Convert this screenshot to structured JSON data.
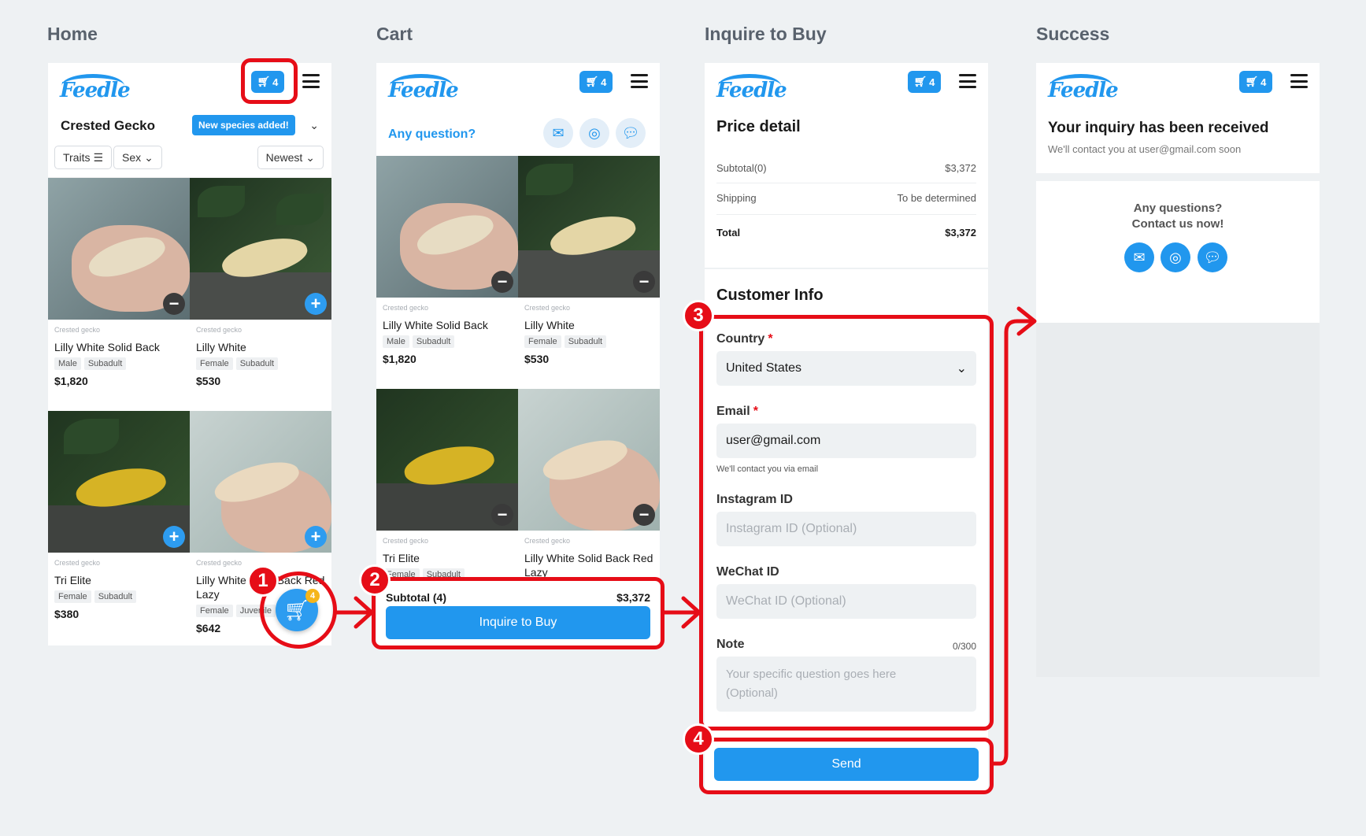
{
  "columns": {
    "home": "Home",
    "cart": "Cart",
    "inquire": "Inquire to Buy",
    "success": "Success"
  },
  "brand": {
    "logo": "Feedle",
    "cart_count": "4",
    "accent": "#2197ee",
    "annotation_color": "#e60d17"
  },
  "home": {
    "species": "Crested Gecko",
    "tooltip": "New species added!",
    "filters": {
      "traits": "Traits",
      "sex": "Sex",
      "sort": "Newest"
    },
    "products": [
      {
        "kind": "Crested gecko",
        "name": "Lilly White Solid Back",
        "tags": [
          "Male",
          "Subadult"
        ],
        "price": "$1,820",
        "action": "minus"
      },
      {
        "kind": "Crested gecko",
        "name": "Lilly White",
        "tags": [
          "Female",
          "Subadult"
        ],
        "price": "$530",
        "action": "plus"
      },
      {
        "kind": "Crested gecko",
        "name": "Tri Elite",
        "tags": [
          "Female",
          "Subadult"
        ],
        "price": "$380",
        "action": "plus"
      },
      {
        "kind": "Crested gecko",
        "name": "Lilly White Solid Back Red Lazy",
        "tags": [
          "Female",
          "Juvenile"
        ],
        "price": "$642",
        "action": "plus"
      }
    ],
    "fab_count": "4"
  },
  "cart": {
    "question": "Any question?",
    "products": [
      {
        "kind": "Crested gecko",
        "name": "Lilly White Solid Back",
        "tags": [
          "Male",
          "Subadult"
        ],
        "price": "$1,820"
      },
      {
        "kind": "Crested gecko",
        "name": "Lilly White",
        "tags": [
          "Female",
          "Subadult"
        ],
        "price": "$530"
      },
      {
        "kind": "Crested gecko",
        "name": "Tri Elite",
        "tags": [
          "Female",
          "Subadult"
        ],
        "price": ""
      },
      {
        "kind": "Crested gecko",
        "name": "Lilly White Solid Back Red Lazy",
        "tags": [],
        "price": ""
      }
    ],
    "subtotal_label": "Subtotal (4)",
    "subtotal_value": "$3,372",
    "button": "Inquire to Buy"
  },
  "inquire": {
    "price_title": "Price detail",
    "subtotal_label": "Subtotal(0)",
    "subtotal_value": "$3,372",
    "shipping_label": "Shipping",
    "shipping_value": "To be determined",
    "total_label": "Total",
    "total_value": "$3,372",
    "customer_title": "Customer Info",
    "country_label": "Country",
    "country_value": "United States",
    "email_label": "Email",
    "email_value": "user@gmail.com",
    "email_help": "We'll contact you via email",
    "instagram_label": "Instagram ID",
    "instagram_placeholder": "Instagram ID (Optional)",
    "wechat_label": "WeChat ID",
    "wechat_placeholder": "WeChat ID (Optional)",
    "note_label": "Note",
    "note_count": "0/300",
    "note_placeholder_1": "Your specific question goes here",
    "note_placeholder_2": "(Optional)",
    "send": "Send"
  },
  "success": {
    "title": "Your inquiry has been received",
    "subtitle": "We'll contact you at user@gmail.com soon",
    "q1": "Any questions?",
    "q2": "Contact us now!"
  },
  "annotations": [
    "1",
    "2",
    "3",
    "4"
  ]
}
